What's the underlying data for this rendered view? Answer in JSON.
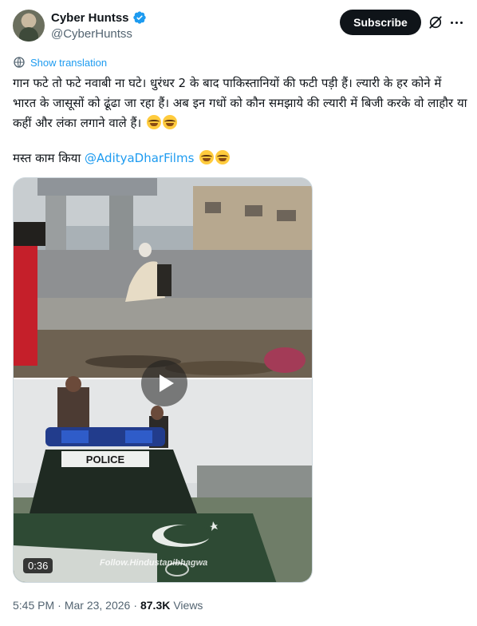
{
  "author": {
    "name": "Cyber Huntss",
    "handle": "@CyberHuntss",
    "verified": true,
    "verified_color": "#1d9bf0"
  },
  "actions": {
    "subscribe_label": "Subscribe",
    "grok_icon": "grok-icon",
    "more_icon": "more-dots-icon"
  },
  "translate": {
    "label": "Show translation",
    "icon": "globe-icon"
  },
  "tweet": {
    "text": "गान फटे तो फटे नवाबी ना घटे। धुरंधर 2 के बाद पाकिस्तानियों की फटी पड़ी हैं। ल्यारी के हर कोने में भारत के जासूसों को ढूंढा जा रहा हैं। अब इन गधों को कौन समझाये की ल्यारी में बिजी करके वो लाहौर या कहीं और लंका लगाने वाले हैं।",
    "line2_prefix": "मस्त काम किया",
    "mention": "@AdityaDharFilms",
    "emoji_name": "face-with-tears-of-joy"
  },
  "media": {
    "type": "video",
    "duration": "0:36",
    "watermark": "Follow.Hindustanibhagwa",
    "vehicle_sign": "POLICE",
    "play_icon": "play-icon"
  },
  "meta": {
    "time": "5:45 PM",
    "separator": "·",
    "date": "Mar 23, 2026",
    "views_count": "87.3K",
    "views_label": "Views"
  },
  "colors": {
    "accent": "#1d9bf0",
    "text": "#0f1419",
    "muted": "#536471"
  }
}
